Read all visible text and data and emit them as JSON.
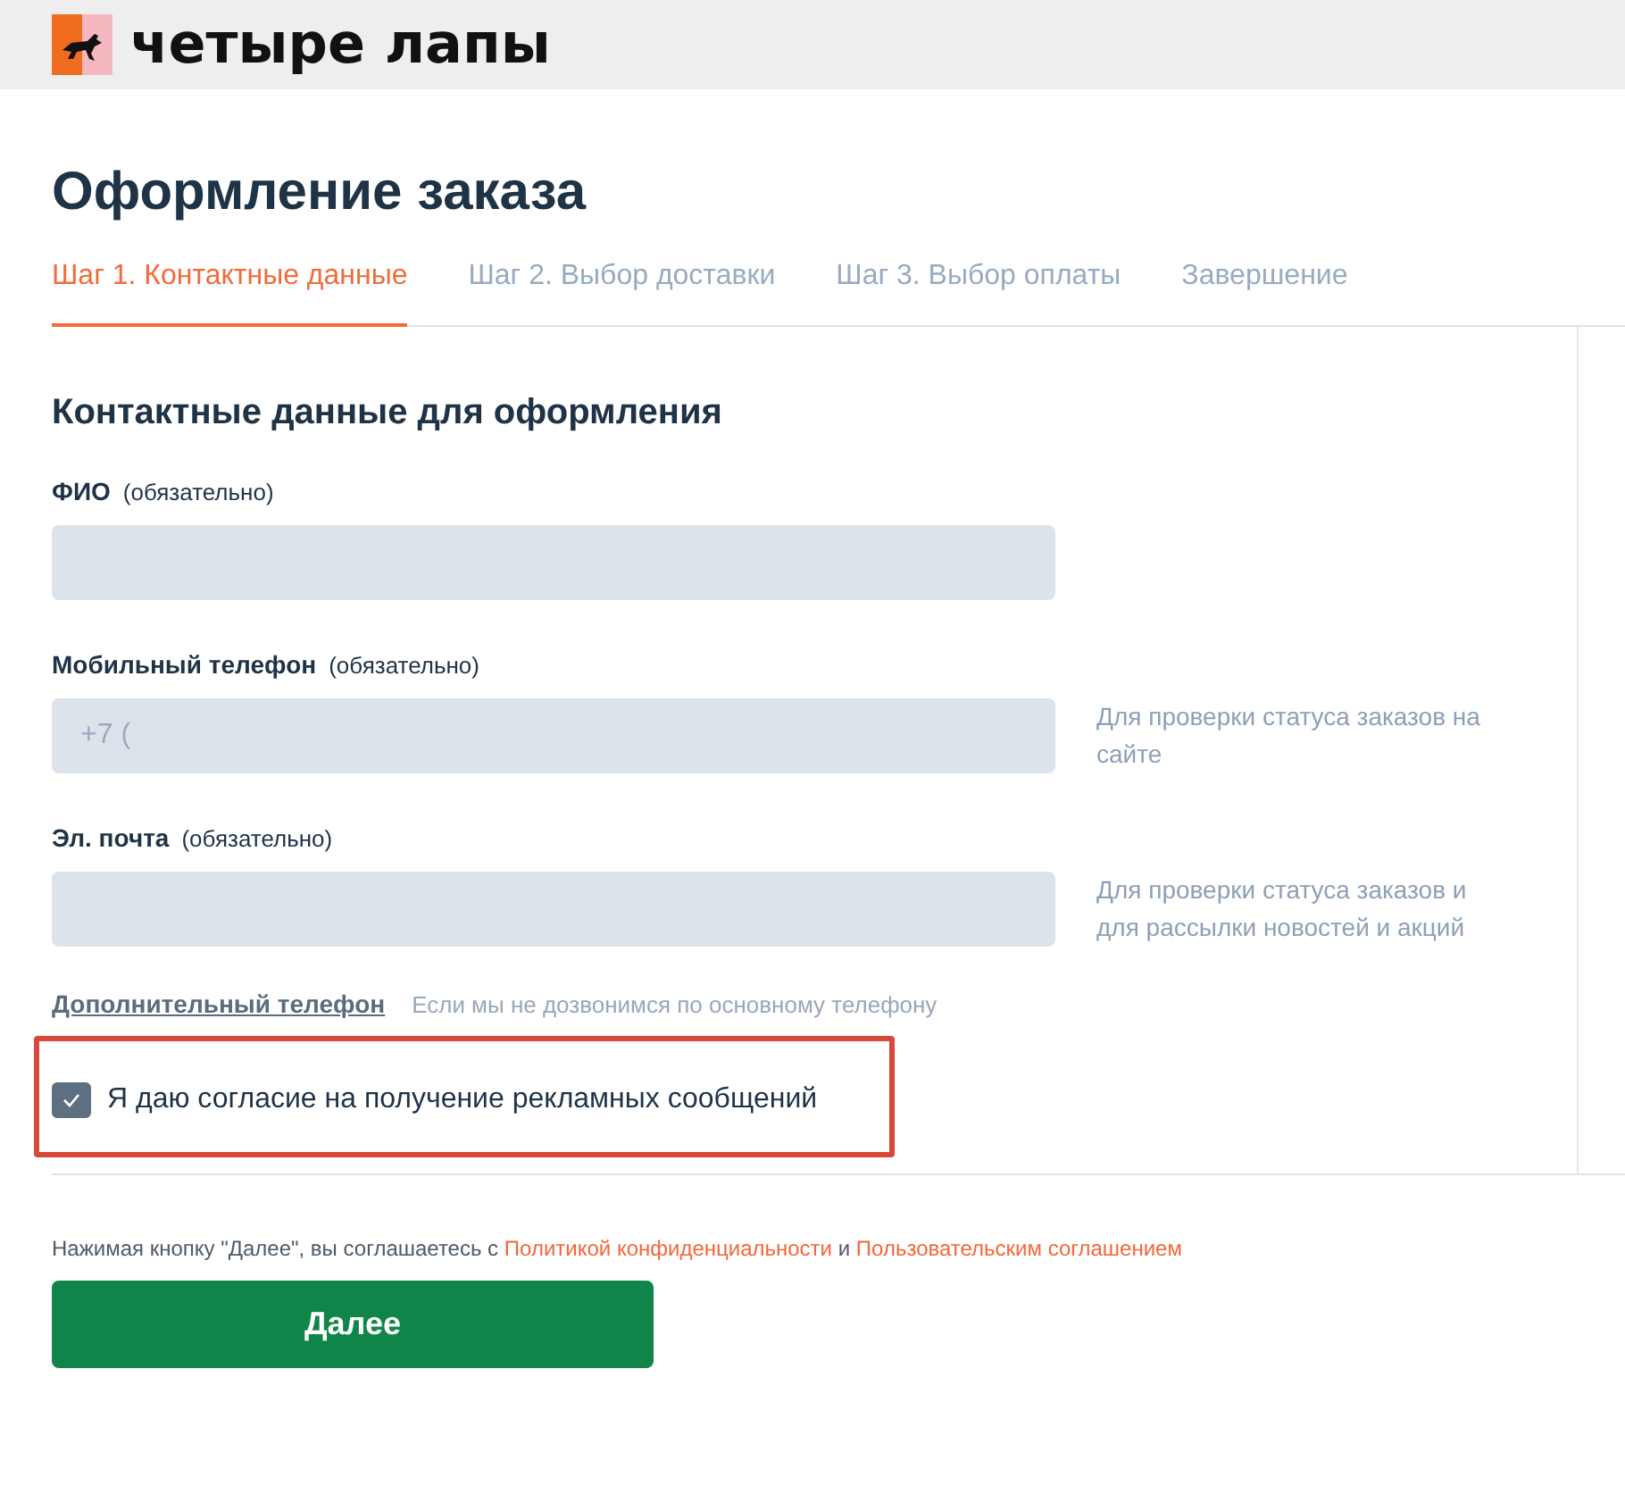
{
  "header": {
    "logo_text": "четыре лапы"
  },
  "title": "Оформление заказа",
  "tabs": [
    {
      "label": "Шаг 1. Контактные данные",
      "selected": true
    },
    {
      "label": "Шаг 2. Выбор доставки",
      "selected": false
    },
    {
      "label": "Шаг 3. Выбор оплаты",
      "selected": false
    },
    {
      "label": "Завершение",
      "selected": false
    }
  ],
  "section_title": "Контактные данные для оформления",
  "fields": [
    {
      "label": "ФИО",
      "required_note": "(обязательно)"
    },
    {
      "label": "Мобильный телефон",
      "required_note": "(обязательно)",
      "placeholder": "+7 (",
      "hint": "Для проверки статуса заказов на сайте"
    },
    {
      "label": "Эл. почта",
      "required_note": "(обязательно)",
      "hint": "Для проверки статуса заказов и для рассылки новостей и акций"
    }
  ],
  "extra_phone": {
    "link": "Дополнительный телефон",
    "note": "Если мы не дозвонимся по основному телефону"
  },
  "consent": {
    "label": "Я даю согласие на получение рекламных сообщений",
    "checked": true,
    "highlighted": true
  },
  "legal_note": [
    {
      "kind": "text",
      "text": "Нажимая кнопку \"Далее\", вы соглашаетесь с"
    },
    {
      "kind": "link",
      "text": "Политикой конфиденциальности"
    },
    {
      "kind": "text",
      "text": "и"
    },
    {
      "kind": "link",
      "text": "Пользовательским соглашением"
    }
  ],
  "next_button": "Далее"
}
